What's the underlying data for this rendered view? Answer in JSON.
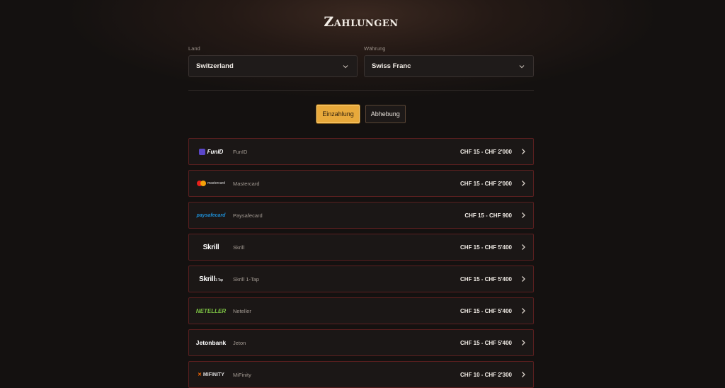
{
  "page": {
    "title": "Zahlungen"
  },
  "filters": {
    "country": {
      "label": "Land",
      "value": "Switzerland"
    },
    "currency": {
      "label": "Währung",
      "value": "Swiss Franc"
    }
  },
  "tabs": [
    {
      "label": "Einzahlung",
      "active": true
    },
    {
      "label": "Abhebung",
      "active": false
    }
  ],
  "methods": [
    {
      "logo": "FunID",
      "name": "FunID",
      "range": "CHF 15 - CHF 2'000"
    },
    {
      "logo": "mastercard",
      "name": "Mastercard",
      "range": "CHF 15 - CHF 2'000"
    },
    {
      "logo": "paysafecard",
      "name": "Paysafecard",
      "range": "CHF 15 - CHF 900"
    },
    {
      "logo": "Skrill",
      "name": "Skrill",
      "range": "CHF 15 - CHF 5'400"
    },
    {
      "logo": "Skrill",
      "logo_sub": "1-Tap",
      "name": "Skrill 1-Tap",
      "range": "CHF 15 - CHF 5'400"
    },
    {
      "logo": "NETELLER",
      "name": "Neteller",
      "range": "CHF 15 - CHF 5'400"
    },
    {
      "logo": "Jetonbank",
      "name": "Jeton",
      "range": "CHF 15 - CHF 5'400"
    },
    {
      "logo": "MIFINITY",
      "name": "MiFinity",
      "range": "CHF 10 - CHF 2'300"
    }
  ],
  "colors": {
    "accent": "#e8a93b",
    "row_border": "#5a1f1f",
    "background": "#141110"
  }
}
